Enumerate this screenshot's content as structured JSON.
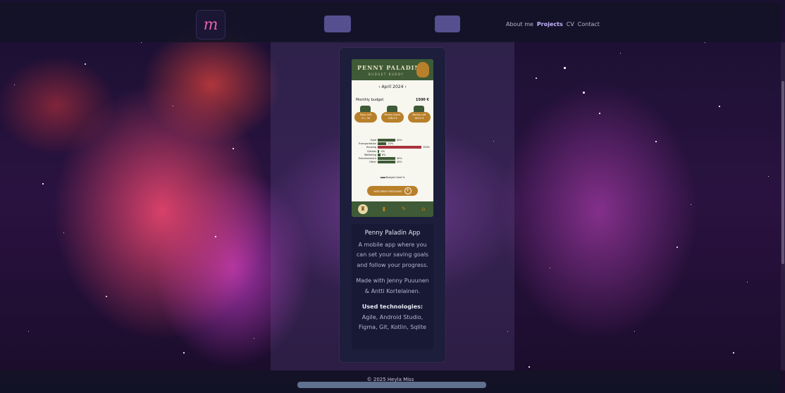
{
  "nav": {
    "logo_letter": "m",
    "links": [
      {
        "label": "About me",
        "active": false
      },
      {
        "label": "Projects",
        "active": true
      },
      {
        "label": "CV",
        "active": false
      },
      {
        "label": "Contact",
        "active": false
      }
    ]
  },
  "app_preview": {
    "title": "PENNY PALADIN",
    "subtitle": "BUDGET BUDDY",
    "month": "April 2024",
    "budget_label": "Monthly budget",
    "budget_value": "1500 €",
    "stats": [
      {
        "label": "Days Left",
        "value": "21 / 30"
      },
      {
        "label": "Money Spent",
        "value": "938.0 €"
      },
      {
        "label": "Money Left",
        "value": "562.0 €"
      }
    ],
    "categories": [
      {
        "label": "Food",
        "pct": "40%",
        "value": 40
      },
      {
        "label": "Transportation",
        "pct": "20%",
        "value": 20
      },
      {
        "label": "Housing",
        "pct": "100%",
        "value": 100
      },
      {
        "label": "Clothes",
        "pct": "4%",
        "value": 4
      },
      {
        "label": "Wellbeing",
        "pct": "6%",
        "value": 6
      },
      {
        "label": "Entertainment",
        "pct": "40%",
        "value": 40
      },
      {
        "label": "Other",
        "pct": "40%",
        "value": 40
      }
    ],
    "legend": "Budget Used %",
    "add_button": "ADD NEW PURCHASE"
  },
  "project": {
    "name": "Penny Paladin App",
    "description": "A mobile app where you can set your saving goals and follow your progress.",
    "credits": "Made with Jenny Puuunen & Antti Kortelainen.",
    "tech_label": "Used technologies:",
    "tech": " Agile, Android Studio, Figma, Git, Kotlin, Sqlite"
  },
  "footer": {
    "text": "© 2025 Heyla Miss"
  },
  "colors": {
    "app_green": "#3e5a36",
    "app_gold": "#b8802a",
    "housing_red": "#a8343e",
    "nav_active": "#c8b5ff"
  }
}
